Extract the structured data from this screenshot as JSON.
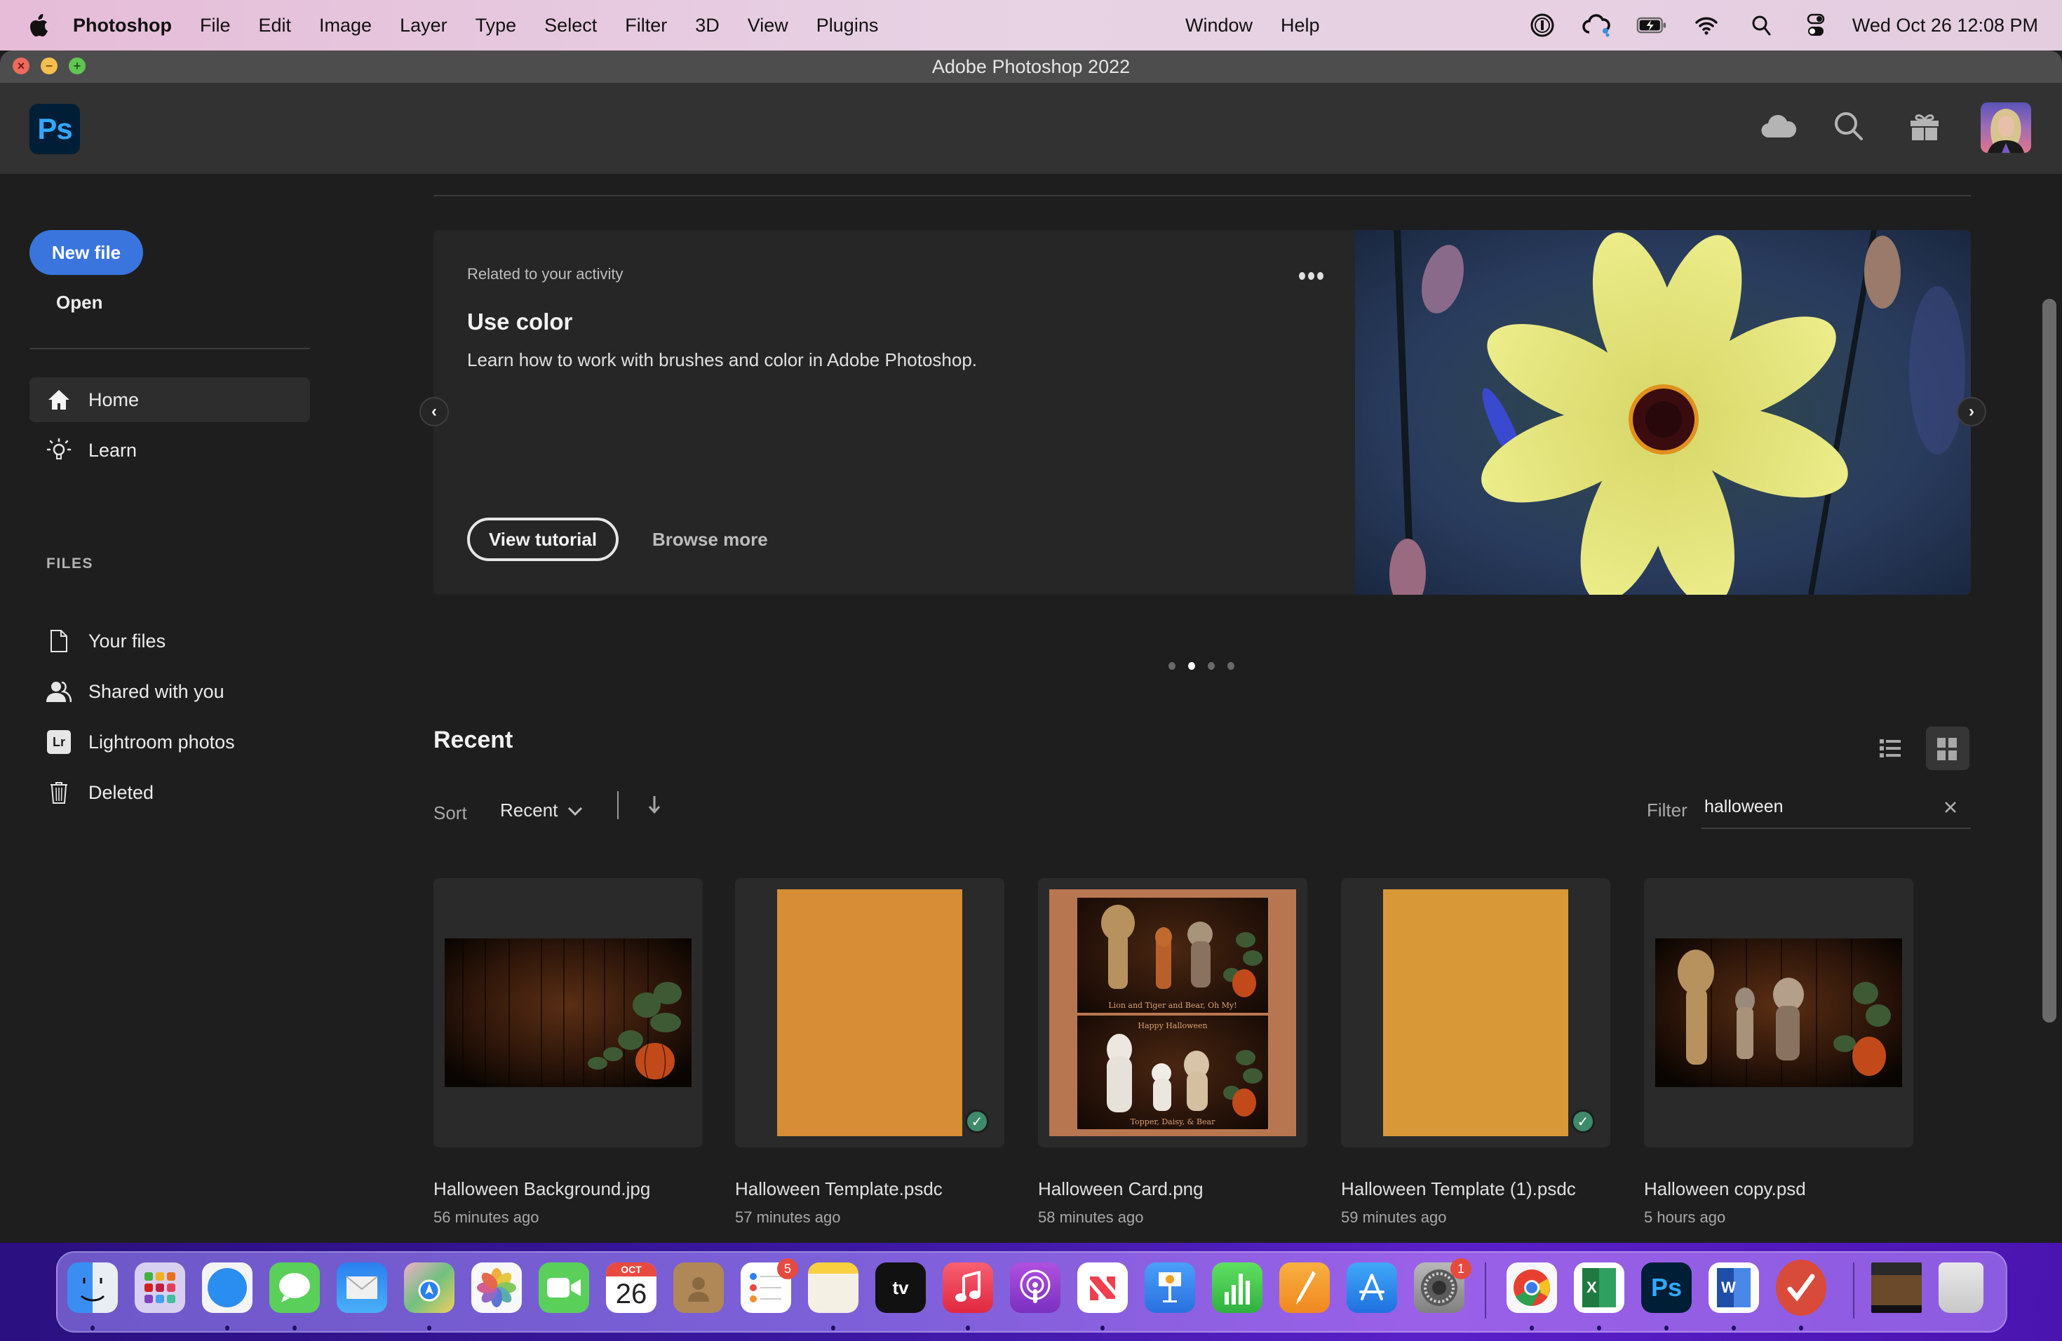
{
  "menubar": {
    "app_name": "Photoshop",
    "items": [
      "File",
      "Edit",
      "Image",
      "Layer",
      "Type",
      "Select",
      "Filter",
      "3D",
      "View",
      "Plugins"
    ],
    "right_items": [
      "Window",
      "Help"
    ],
    "status_icons": [
      "1password-icon",
      "creative-cloud-icon",
      "battery-charging-icon",
      "wifi-icon",
      "spotlight-search-icon",
      "control-center-icon"
    ],
    "clock": "Wed Oct 26  12:08 PM"
  },
  "window": {
    "title": "Adobe Photoshop 2022"
  },
  "app_header": {
    "logo_text": "Ps",
    "icons": [
      "cloud-icon",
      "search-icon",
      "gift-icon"
    ],
    "avatar_label": "User avatar"
  },
  "sidebar": {
    "new_file_label": "New file",
    "open_label": "Open",
    "nav": [
      {
        "label": "Home",
        "icon": "home-icon",
        "active": true
      },
      {
        "label": "Learn",
        "icon": "lightbulb-icon",
        "active": false
      }
    ],
    "files_heading": "FILES",
    "files": [
      {
        "label": "Your files",
        "icon": "document-icon"
      },
      {
        "label": "Shared with you",
        "icon": "users-icon"
      },
      {
        "label": "Lightroom photos",
        "icon": "lightroom-icon",
        "badge": "Lr"
      },
      {
        "label": "Deleted",
        "icon": "trash-icon"
      }
    ]
  },
  "banner": {
    "eyebrow": "Related to your activity",
    "title": "Use color",
    "description": "Learn how to work with brushes and color in Adobe Photoshop.",
    "primary_button": "View tutorial",
    "secondary_link": "Browse more",
    "prev_arrow": "‹",
    "next_arrow": "›",
    "slide_count": 4,
    "active_slide": 2
  },
  "recent": {
    "title": "Recent",
    "sort_label": "Sort",
    "sort_value": "Recent",
    "filter_label": "Filter",
    "filter_value": "halloween",
    "view_mode": "grid",
    "files": [
      {
        "name": "Halloween Background.jpg",
        "time": "56 minutes ago",
        "thumb": "wood-pumpkin",
        "synced": false
      },
      {
        "name": "Halloween Template.psdc",
        "time": "57 minutes ago",
        "thumb": "orange-portrait",
        "synced": true
      },
      {
        "name": "Halloween Card.png",
        "time": "58 minutes ago",
        "thumb": "card",
        "synced": false
      },
      {
        "name": "Halloween Template (1).psdc",
        "time": "59 minutes ago",
        "thumb": "orange-portrait",
        "synced": true
      },
      {
        "name": "Halloween copy.psd",
        "time": "5 hours ago",
        "thumb": "dogs-pumpkin",
        "synced": false
      }
    ],
    "card_text": {
      "top_caption": "Lion and Tiger and Bear, Oh My!",
      "bottom_heading": "Happy Halloween",
      "bottom_caption": "Topper, Daisy, & Bear"
    }
  },
  "colors": {
    "accent": "#3a75dd",
    "ps_blue": "#31a8ff",
    "ps_navy": "#001e36",
    "synced_check": "#3e8a6a",
    "template_orange": "#d78d35"
  },
  "dock": {
    "apps": [
      {
        "name": "Finder",
        "running": true
      },
      {
        "name": "Launchpad",
        "running": false
      },
      {
        "name": "Safari",
        "running": true
      },
      {
        "name": "Messages",
        "running": true
      },
      {
        "name": "Mail",
        "running": false
      },
      {
        "name": "Maps",
        "running": true
      },
      {
        "name": "Photos",
        "running": false
      },
      {
        "name": "FaceTime",
        "running": false
      },
      {
        "name": "Calendar",
        "running": false,
        "month": "OCT",
        "day": "26"
      },
      {
        "name": "Contacts",
        "running": false
      },
      {
        "name": "Reminders",
        "running": false,
        "badge": "5"
      },
      {
        "name": "Notes",
        "running": true
      },
      {
        "name": "TV",
        "running": false,
        "label": "tv"
      },
      {
        "name": "Music",
        "running": true
      },
      {
        "name": "Podcasts",
        "running": false
      },
      {
        "name": "News",
        "running": true
      },
      {
        "name": "Keynote",
        "running": false
      },
      {
        "name": "Numbers",
        "running": false
      },
      {
        "name": "Pages",
        "running": false
      },
      {
        "name": "App Store",
        "running": false
      },
      {
        "name": "System Preferences",
        "running": false,
        "badge": "1"
      },
      {
        "name": "Google Chrome",
        "running": true
      },
      {
        "name": "Microsoft Excel",
        "running": true,
        "label": "X"
      },
      {
        "name": "Adobe Photoshop",
        "running": true,
        "label": "Ps"
      },
      {
        "name": "Microsoft Word",
        "running": true,
        "label": "W"
      },
      {
        "name": "Wunderlist",
        "running": true
      },
      {
        "name": "Downloads stack",
        "running": false
      },
      {
        "name": "Trash",
        "running": false
      }
    ]
  }
}
